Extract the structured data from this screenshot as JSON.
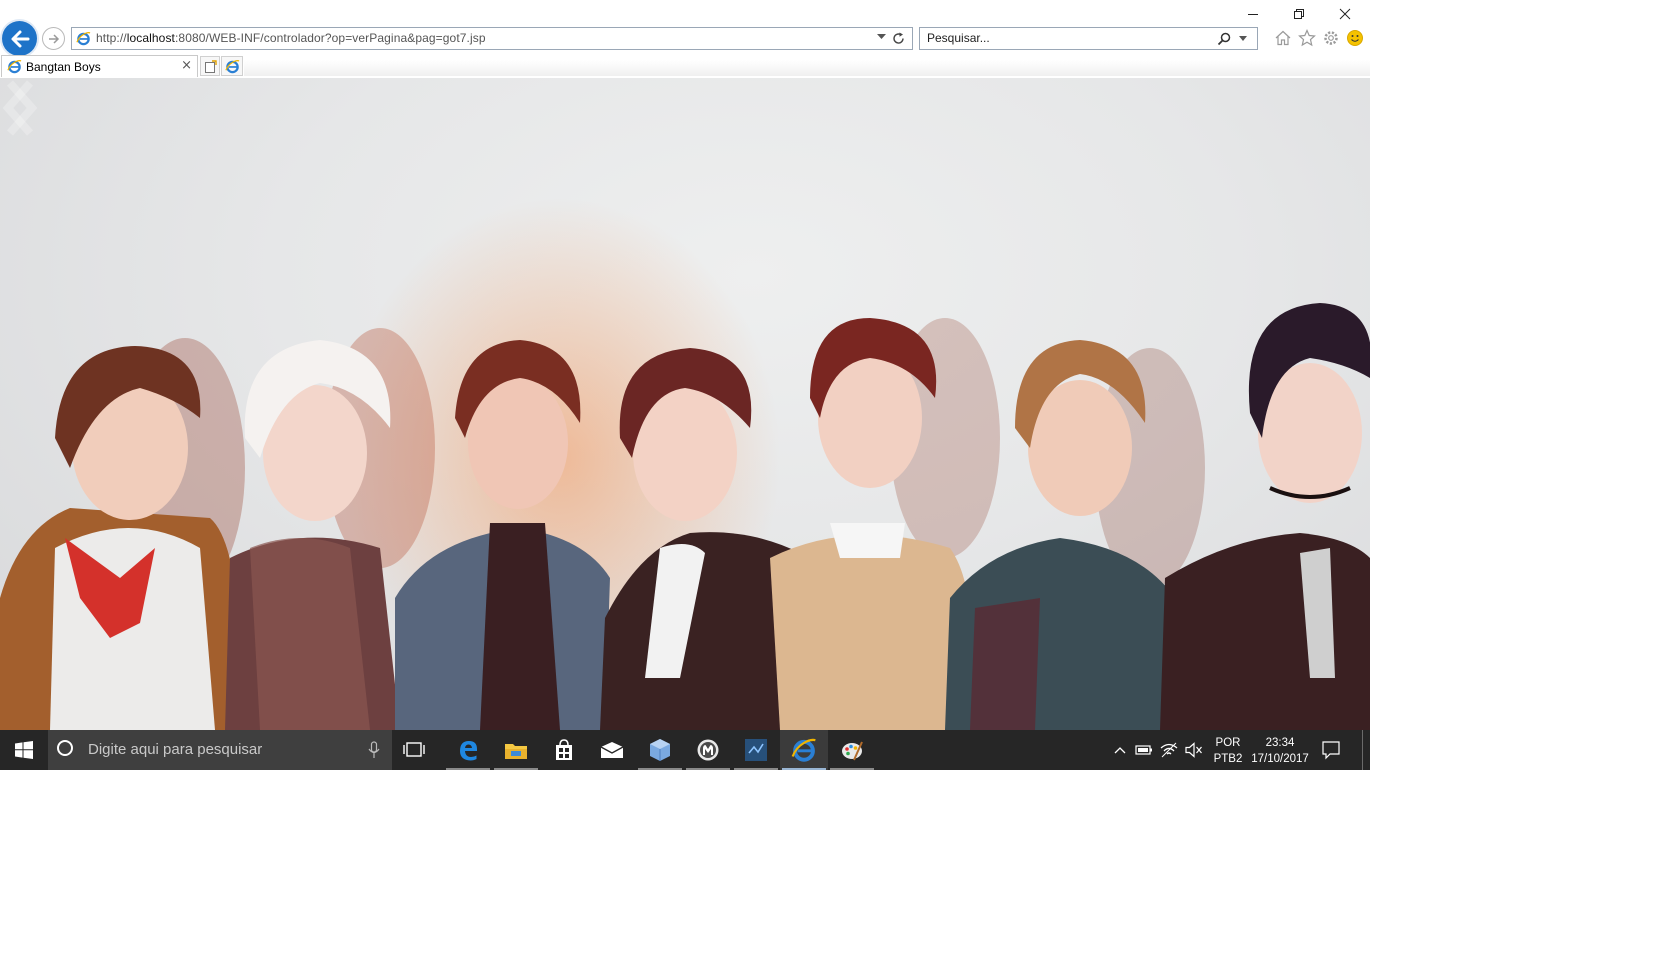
{
  "browser": {
    "address": {
      "url_prefix": "http://",
      "url_host": "localhost",
      "url_rest": ":8080/WEB-INF/controlador?op=verPagina&pag=got7.jsp"
    },
    "search": {
      "placeholder": "Pesquisar..."
    },
    "tabs": [
      {
        "title": "Bangtan Boys"
      }
    ],
    "tab_close": "×"
  },
  "taskbar": {
    "search_placeholder": "Digite aqui para pesquisar",
    "language": {
      "line1": "POR",
      "line2": "PTB2"
    },
    "clock": {
      "time": "23:34",
      "date": "17/10/2017"
    },
    "apps": [
      "edge-icon",
      "file-explorer-icon",
      "store-icon",
      "mail-icon",
      "virtualbox-icon",
      "media-icon",
      "vs-code-icon",
      "internet-explorer-icon",
      "paint-icon"
    ]
  },
  "colors": {
    "accent": "#1e73c8",
    "taskbar": "#262626",
    "taskbar_search": "#3f3f3f"
  }
}
